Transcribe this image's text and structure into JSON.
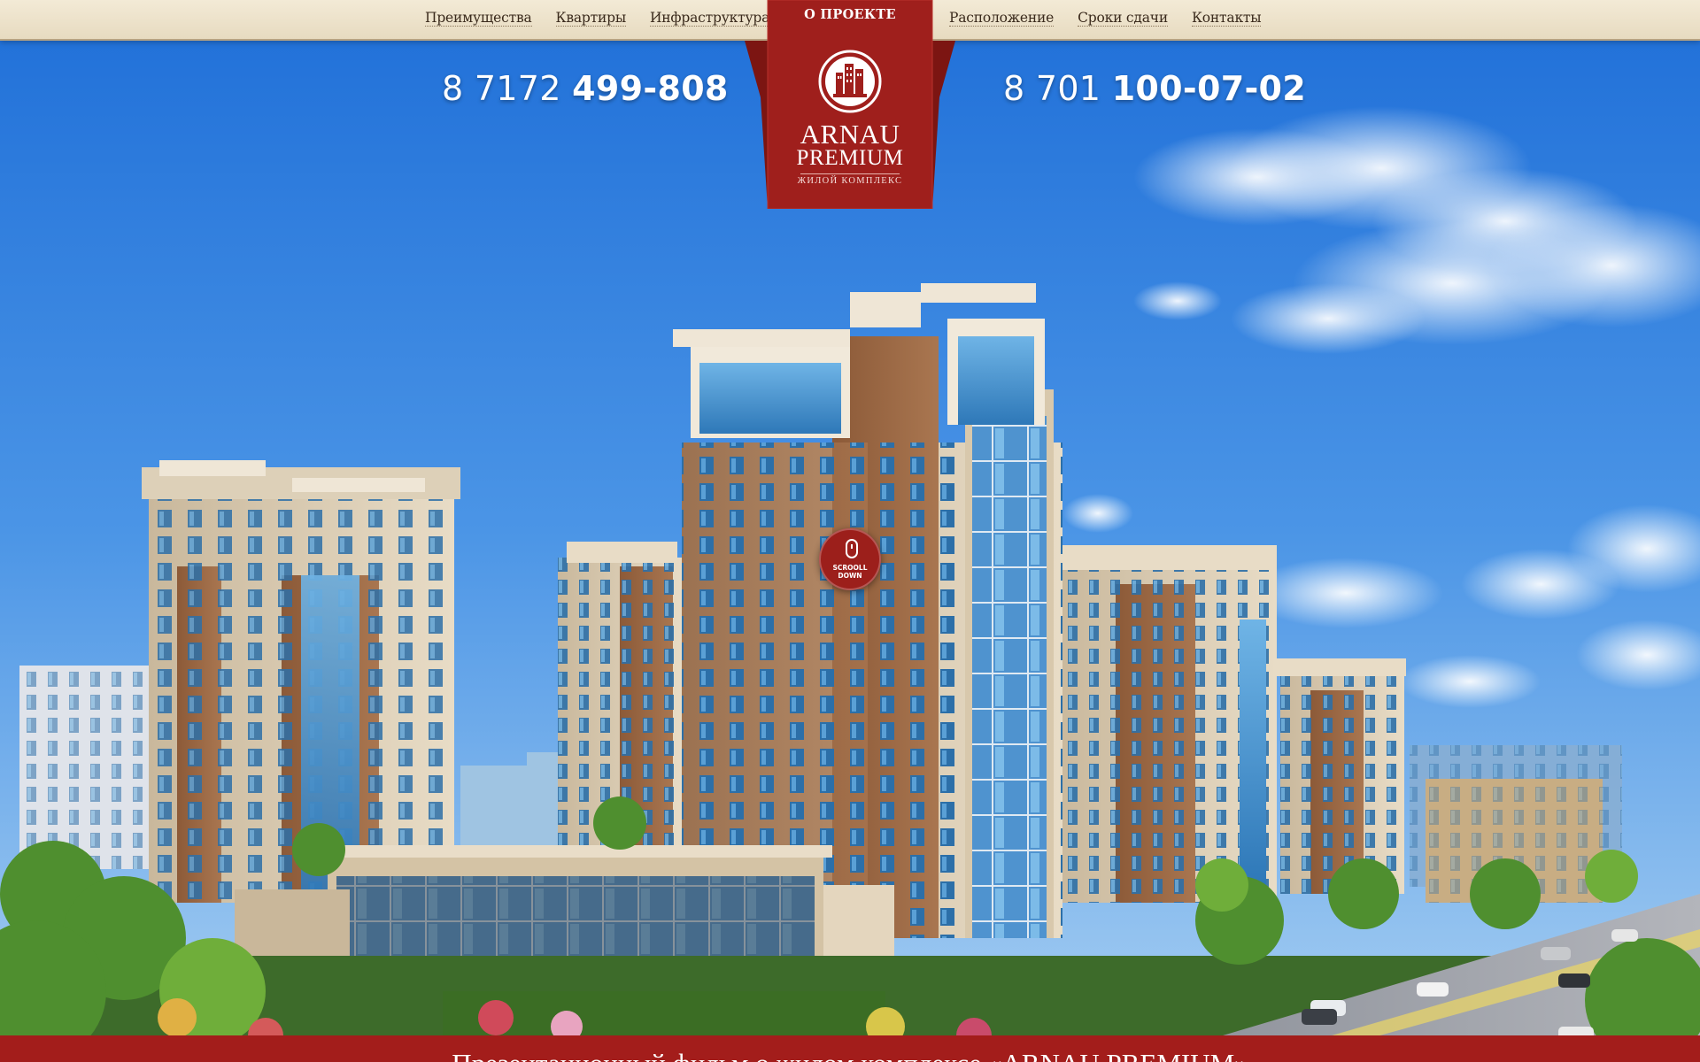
{
  "nav": {
    "left": [
      {
        "label": "Преимущества"
      },
      {
        "label": "Квартиры"
      },
      {
        "label": "Инфраструктура"
      }
    ],
    "active_label": "О ПРОЕКТЕ",
    "right": [
      {
        "label": "Расположение"
      },
      {
        "label": "Сроки сдачи"
      },
      {
        "label": "Контакты"
      }
    ]
  },
  "brand": {
    "line1": "ARNAU",
    "line2": "PREMIUM",
    "tagline": "ЖИЛОЙ КОМПЛЕКС"
  },
  "phones": [
    {
      "code": "8 7172",
      "number": "499-808"
    },
    {
      "code": "8 701",
      "number": "100-07-02"
    }
  ],
  "scroll": {
    "line1": "SCROOLL",
    "line2": "DOWN"
  },
  "bottom": {
    "title": "Презентационный фильм о жилом комплексе «ARNAU PREMIUM»"
  },
  "colors": {
    "accent_red": "#9c1f1b",
    "nav_bg": "#efe5cf",
    "sky": "#3d86de"
  },
  "icons": {
    "logo": "buildings-emblem-icon",
    "scroll": "mouse-icon"
  }
}
